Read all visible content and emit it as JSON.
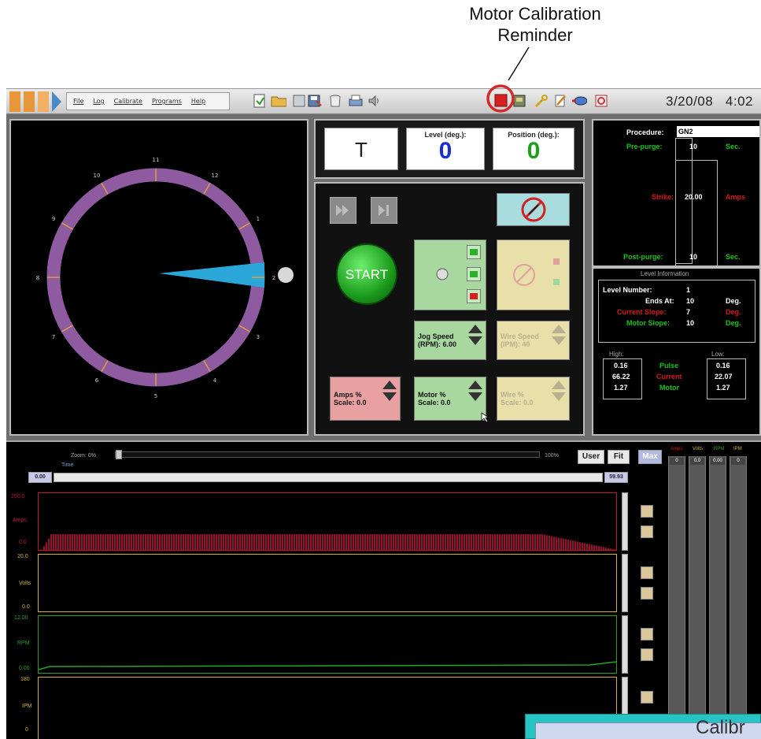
{
  "annotation": {
    "line1": "Motor Calibration",
    "line2": "Reminder"
  },
  "menu": [
    "File",
    "Log",
    "Calibrate",
    "Programs",
    "Help"
  ],
  "toolbar": {
    "date": "3/20/08",
    "time": "4:02",
    "icons": [
      "new-file-icon",
      "open-folder-icon",
      "disk-icon",
      "save-icon",
      "trash-icon",
      "print-icon",
      "sound-icon",
      "motor-calibration-reminder-icon",
      "calibration-icon",
      "wrench-icon",
      "pencil-icon",
      "arrow-icon",
      "settings-icon"
    ]
  },
  "dial": {
    "labels": [
      "10",
      "11",
      "12",
      "1",
      "2",
      "3",
      "4",
      "5",
      "6",
      "7",
      "8",
      "9"
    ]
  },
  "readouts": {
    "mode": "T",
    "level_label": "Level (deg.):",
    "level_value": "0",
    "position_label": "Position (deg.):",
    "position_value": "0"
  },
  "controls": {
    "start": "START",
    "jog_speed_line1": "Jog Speed",
    "jog_speed_line2": "(RPM): 6.00",
    "wire_speed_line1": "Wire Speed",
    "wire_speed_line2": "(IPM): 40",
    "amps_line1": "Amps %",
    "amps_line2": "Scale: 0.0",
    "motor_line1": "Motor %",
    "motor_line2": "Scale: 0.0",
    "wire_pct_line1": "Wire %",
    "wire_pct_line2": "Scale: 0.0"
  },
  "procedure": {
    "procedure_label": "Procedure:",
    "procedure_value": "GN2",
    "pre_purge_label": "Pre-purge:",
    "pre_purge_value": "10",
    "pre_purge_unit": "Sec.",
    "strike_label": "Strike:",
    "strike_value": "20.00",
    "strike_unit": "Amps",
    "post_purge_label": "Post-purge:",
    "post_purge_value": "10",
    "post_purge_unit": "Sec."
  },
  "level_info": {
    "title": "Level Information",
    "level_number_label": "Level Number:",
    "level_number_value": "1",
    "ends_at_label": "Ends At:",
    "ends_at_value": "10",
    "ends_at_unit": "Deg.",
    "current_slope_label": "Current Slope:",
    "current_slope_value": "7",
    "current_slope_unit": "Deg.",
    "motor_slope_label": "Motor Slope:",
    "motor_slope_value": "10",
    "motor_slope_unit": "Deg.",
    "high_label": "High:",
    "low_label": "Low:",
    "pulse_label": "Pulse",
    "current_label": "Current",
    "motor_label": "Motor",
    "high_values": [
      "0.16",
      "66.22",
      "1.27"
    ],
    "low_values": [
      "0.16",
      "22.07",
      "1.27"
    ]
  },
  "graphs": {
    "zoom_label": "Zoom: 0%",
    "zoom_max": "100%",
    "time_label": "Time",
    "time_start": "0.00",
    "time_end": "59.93",
    "user_button": "User",
    "fit_button": "Fit",
    "max_button": "Max",
    "amps_max": "250.0",
    "amps_label": "Amps",
    "amps_min": "0.0",
    "volts_max": "20.0",
    "volts_label": "Volts",
    "volts_min": "0.0",
    "rpm_max": "12.00",
    "rpm_label": "RPM",
    "rpm_min": "0.00",
    "ipm_max": "180",
    "ipm_label": "IPM",
    "ipm_min": "0",
    "meter_headers": [
      "Amps",
      "Volts",
      "RPM",
      "IPM"
    ],
    "meter_values": [
      "0",
      "0.0",
      "0.00",
      "0"
    ]
  },
  "popup": {
    "title": "Calibr"
  },
  "colors": {
    "amps_trace": "#c0143c",
    "rpm_trace": "#2aa12a",
    "dial_ring": "#8e5aa0",
    "pointer": "#2aa6d8",
    "reminder_circle": "#d42a2a"
  }
}
